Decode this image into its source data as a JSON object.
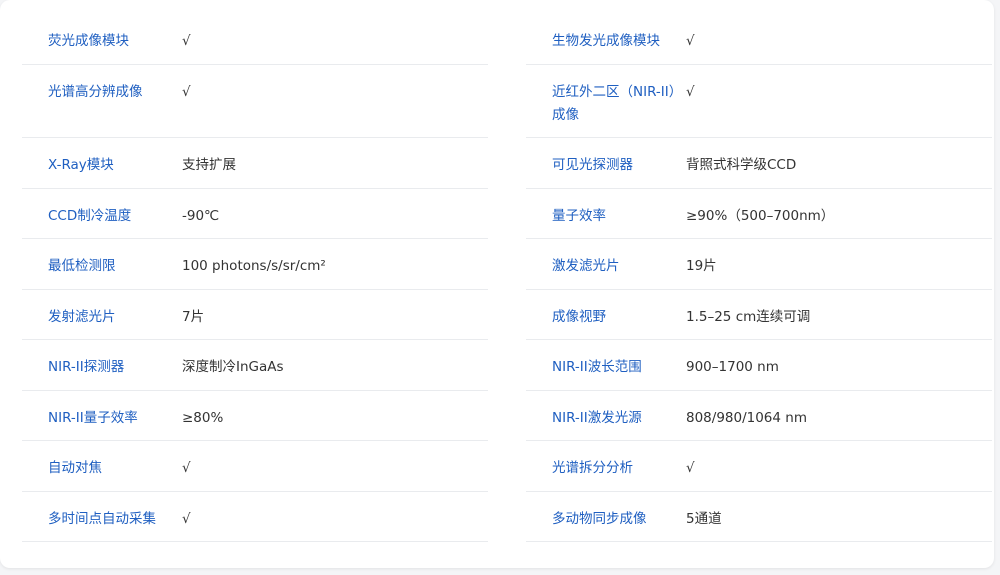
{
  "colors": {
    "label": "#1f5fc1",
    "value": "#333333",
    "divider": "#e9ebee",
    "background": "#f4f5f7",
    "card": "#ffffff"
  },
  "left_rows": [
    {
      "label": "荧光成像模块",
      "value": "√"
    },
    {
      "label": "光谱高分辨成像",
      "value": "√"
    },
    {
      "label": "X-Ray模块",
      "value": "支持扩展"
    },
    {
      "label": "CCD制冷温度",
      "value": "-90℃"
    },
    {
      "label": "最低检测限",
      "value": "100 photons/s/sr/cm²"
    },
    {
      "label": "发射滤光片",
      "value": "7片"
    },
    {
      "label": "NIR-II探测器",
      "value": "深度制冷InGaAs"
    },
    {
      "label": "NIR-II量子效率",
      "value": "≥80%"
    },
    {
      "label": "自动对焦",
      "value": "√"
    },
    {
      "label": "多时间点自动采集",
      "value": "√"
    }
  ],
  "right_rows": [
    {
      "label": "生物发光成像模块",
      "value": "√"
    },
    {
      "label": "近红外二区（NIR-II）成像",
      "value": "√"
    },
    {
      "label": "可见光探测器",
      "value": "背照式科学级CCD"
    },
    {
      "label": "量子效率",
      "value": "≥90%（500–700nm）"
    },
    {
      "label": "激发滤光片",
      "value": "19片"
    },
    {
      "label": "成像视野",
      "value": "1.5–25 cm连续可调"
    },
    {
      "label": "NIR-II波长范围",
      "value": "900–1700 nm"
    },
    {
      "label": "NIR-II激发光源",
      "value": "808/980/1064 nm"
    },
    {
      "label": "光谱拆分分析",
      "value": "√"
    },
    {
      "label": "多动物同步成像",
      "value": "5通道"
    }
  ]
}
